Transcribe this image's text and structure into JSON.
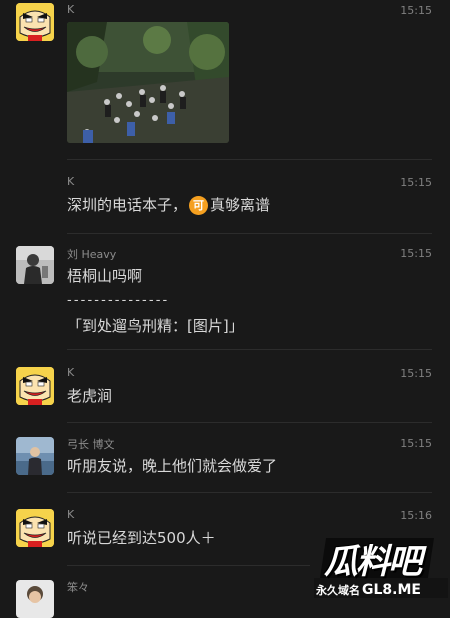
{
  "messages": [
    {
      "sender": "K",
      "time": "15:15",
      "type": "image",
      "image_alt": "crowd in forest photo"
    },
    {
      "sender": "K",
      "time": "15:15",
      "text_before": "深圳的电话本子，",
      "badge": "可",
      "text_after": "真够离谱"
    },
    {
      "sender": "刘 Heavy",
      "time": "15:15",
      "line1": "梧桐山吗啊",
      "line2": "- - - - - - - - - - - - - - -",
      "line3": "「到处遛鸟刑精：[图片]」"
    },
    {
      "sender": "K",
      "time": "15:15",
      "text": "老虎涧"
    },
    {
      "sender": "弓长 博文",
      "time": "15:15",
      "text": "听朋友说，晚上他们就会做爱了"
    },
    {
      "sender": "K",
      "time": "15:16",
      "text": "听说已经到达500人＋"
    },
    {
      "sender": "笨々",
      "time": ""
    }
  ],
  "watermark": {
    "logo": "瓜料吧",
    "tagline": "永久域名",
    "domain": "GL8.ME"
  },
  "colors": {
    "background": "#191919",
    "badge": "#f5a020",
    "avatar_yellow": "#f6d34b"
  }
}
